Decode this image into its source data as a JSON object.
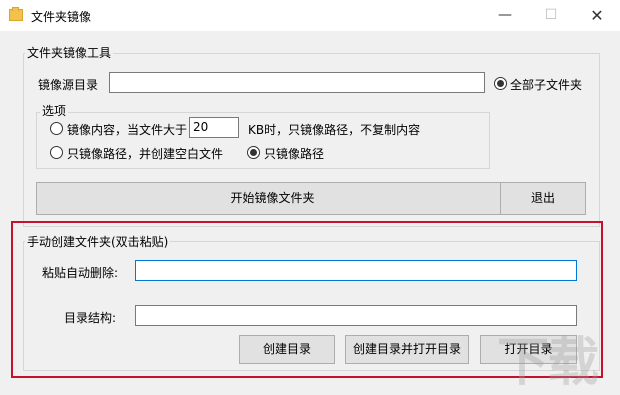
{
  "window": {
    "title": "文件夹镜像",
    "minimize": "—",
    "maximize": "☐",
    "close": "✕"
  },
  "tool_group": {
    "title": "文件夹镜像工具",
    "source_dir_label": "镜像源目录",
    "source_dir_value": "",
    "all_subfolders_label": "全部子文件夹",
    "all_subfolders_checked": true,
    "options": {
      "title": "选项",
      "mirror_content_label": "镜像内容，当文件大于",
      "size_value": "20",
      "size_suffix": "KB时，只镜像路径，不复制内容",
      "blank_files_label": "只镜像路径，并创建空白文件",
      "paths_only_label": "只镜像路径",
      "selected": "paths_only"
    },
    "start_button": "开始镜像文件夹",
    "exit_button": "退出"
  },
  "manual_group": {
    "title": "手动创建文件夹(双击粘贴)",
    "paste_label": "粘贴自动删除:",
    "paste_value": "",
    "structure_label": "目录结构:",
    "structure_value": "",
    "create_button": "创建目录",
    "create_open_button": "创建目录并打开目录",
    "open_button": "打开目录"
  },
  "highlight_color": "#c8102e",
  "watermark": "下载"
}
